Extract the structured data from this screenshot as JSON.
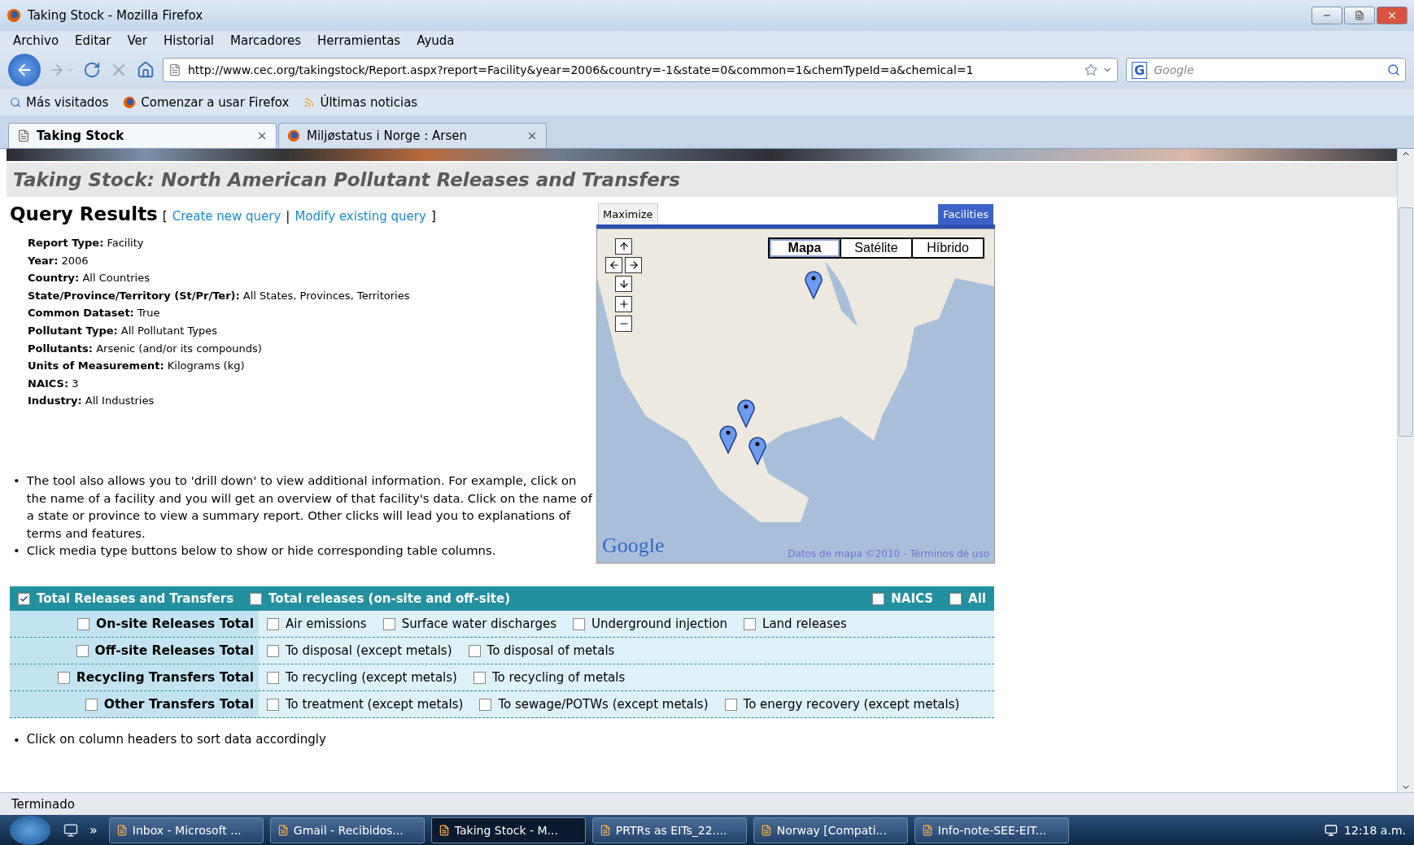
{
  "window": {
    "title": "Taking Stock - Mozilla Firefox"
  },
  "menu": [
    "Archivo",
    "Editar",
    "Ver",
    "Historial",
    "Marcadores",
    "Herramientas",
    "Ayuda"
  ],
  "address": {
    "value": "http://www.cec.org/takingstock/Report.aspx?report=Facility&year=2006&country=-1&state=0&common=1&chemTypeId=a&chemical=1"
  },
  "search": {
    "engine": "G",
    "placeholder": "Google"
  },
  "bookmarks": [
    "Más visitados",
    "Comenzar a usar Firefox",
    "Últimas noticias"
  ],
  "tabs": [
    {
      "label": "Taking Stock",
      "selected": true
    },
    {
      "label": "Miljøstatus i Norge : Arsen",
      "selected": false
    }
  ],
  "page": {
    "heading": "Taking Stock: North American Pollutant Releases and Transfers",
    "title": "Query Results",
    "open": "[",
    "links": [
      "Create new query",
      "Modify existing query"
    ],
    "separator": "|",
    "close": "]",
    "details": [
      "**Report Type:** Facility",
      "**Year:** 2006",
      "**Country:** All Countries",
      "**State/Province/Territory (St/Pr/Ter):** All States, Provinces, Territories",
      "**Common Dataset:** True",
      "**Pollutant Type:** All Pollutant Types",
      "**Pollutants:** Arsenic (and/or its compounds)",
      "**Units of Measurement:** Kilograms (kg)",
      "**NAICS:** 3",
      "**Industry:** All Industries"
    ],
    "notes": [
      "The tool also allows you to 'drill down' to view additional information. For example, click on the name of a facility and you will get an overview of that facility's data. Click on the name of a state or province to view a summary report. Other clicks will lead you to explanations of terms and features.",
      "Click media type buttons below to show or hide corresponding table columns."
    ],
    "bullet": "•",
    "footnote": "Click on column headers to sort data accordingly"
  },
  "map": {
    "maximize": "Maximize",
    "layer": "Facilities",
    "types": [
      {
        "label": "Mapa",
        "selected": true
      },
      {
        "label": "Satélite",
        "selected": false
      },
      {
        "label": "Híbrido",
        "selected": false
      }
    ],
    "logo": "Google",
    "credit": "Datos de mapa ©2010",
    "dash": "-",
    "terms": "Términos de uso"
  },
  "filters": {
    "header": [
      {
        "label": "Total Releases and Transfers",
        "checked": true
      },
      {
        "label": "Total releases (on-site and off-site)",
        "checked": false
      }
    ],
    "header_right": [
      {
        "label": "NAICS",
        "checked": false
      },
      {
        "label": "All",
        "checked": false
      }
    ],
    "rows": [
      {
        "total": {
          "label": "On-site Releases Total",
          "checked": false
        },
        "items": [
          {
            "label": "Air emissions",
            "checked": false
          },
          {
            "label": "Surface water discharges",
            "checked": false
          },
          {
            "label": "Underground injection",
            "checked": false
          },
          {
            "label": "Land releases",
            "checked": false
          }
        ]
      },
      {
        "total": {
          "label": "Off-site Releases Total",
          "checked": false
        },
        "items": [
          {
            "label": "To disposal (except metals)",
            "checked": false
          },
          {
            "label": "To disposal of metals",
            "checked": false
          }
        ]
      },
      {
        "total": {
          "label": "Recycling Transfers Total",
          "checked": false
        },
        "items": [
          {
            "label": "To recycling (except metals)",
            "checked": false
          },
          {
            "label": "To recycling of metals",
            "checked": false
          }
        ]
      },
      {
        "total": {
          "label": "Other Transfers Total",
          "checked": false
        },
        "items": [
          {
            "label": "To treatment (except metals)",
            "checked": false
          },
          {
            "label": "To sewage/POTWs (except metals)",
            "checked": false
          },
          {
            "label": "To energy recovery (except metals)",
            "checked": false
          }
        ]
      }
    ]
  },
  "status": "Terminado",
  "taskbar": {
    "more": "»",
    "items": [
      {
        "label": "Inbox - Microsoft ...",
        "selected": false
      },
      {
        "label": "Gmail - Recibidos...",
        "selected": false
      },
      {
        "label": "Taking Stock - M...",
        "selected": true
      },
      {
        "label": "PRTRs as EITs_22....",
        "selected": false
      },
      {
        "label": "Norway [Compati...",
        "selected": false
      },
      {
        "label": "Info-note-SEE-EIT...",
        "selected": false
      }
    ],
    "clock": "12:18 a.m."
  }
}
